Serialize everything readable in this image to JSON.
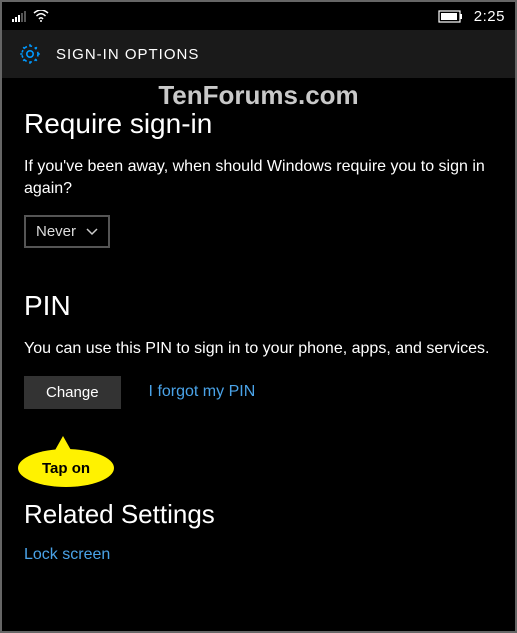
{
  "status": {
    "time": "2:25"
  },
  "header": {
    "title": "SIGN-IN OPTIONS"
  },
  "watermark": "TenForums.com",
  "require": {
    "title": "Require sign-in",
    "desc": "If you've been away, when should Windows require you to sign in again?",
    "dropdown_value": "Never"
  },
  "pin": {
    "title": "PIN",
    "desc": "You can use this PIN to sign in to your phone, apps, and services.",
    "change_label": "Change",
    "forgot_label": "I forgot my PIN"
  },
  "callout": "Tap on",
  "related": {
    "title": "Related Settings",
    "link": "Lock screen"
  }
}
